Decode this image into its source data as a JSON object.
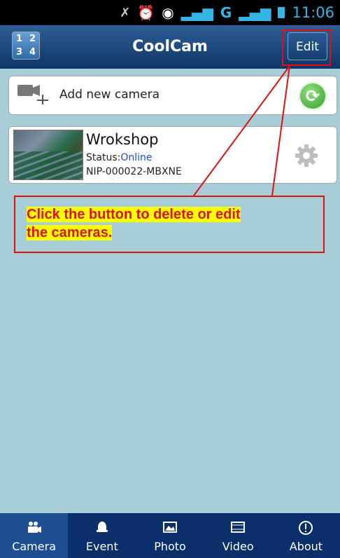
{
  "status_bar": {
    "time": "11:06",
    "network": "G"
  },
  "header": {
    "title": "CoolCam",
    "edit_label": "Edit",
    "grid_labels": [
      "1",
      "2",
      "3",
      "4"
    ]
  },
  "add_camera": {
    "label": "Add new camera"
  },
  "camera": {
    "name": "Wrokshop",
    "status_label": "Status:",
    "status_value": "Online",
    "id": "NIP-000022-MBXNE"
  },
  "annotation": {
    "line1": "Click the button to delete or edit",
    "line2": "the cameras."
  },
  "tabs": [
    {
      "label": "Camera",
      "icon": "camera-icon"
    },
    {
      "label": "Event",
      "icon": "bell-icon"
    },
    {
      "label": "Photo",
      "icon": "photo-icon"
    },
    {
      "label": "Video",
      "icon": "film-icon"
    },
    {
      "label": "About",
      "icon": "info-icon"
    }
  ],
  "colors": {
    "accent_red": "#e01010",
    "highlight": "#ffff00",
    "nav_bg": "#0b2f6b",
    "status_online": "#1a4fd8"
  }
}
